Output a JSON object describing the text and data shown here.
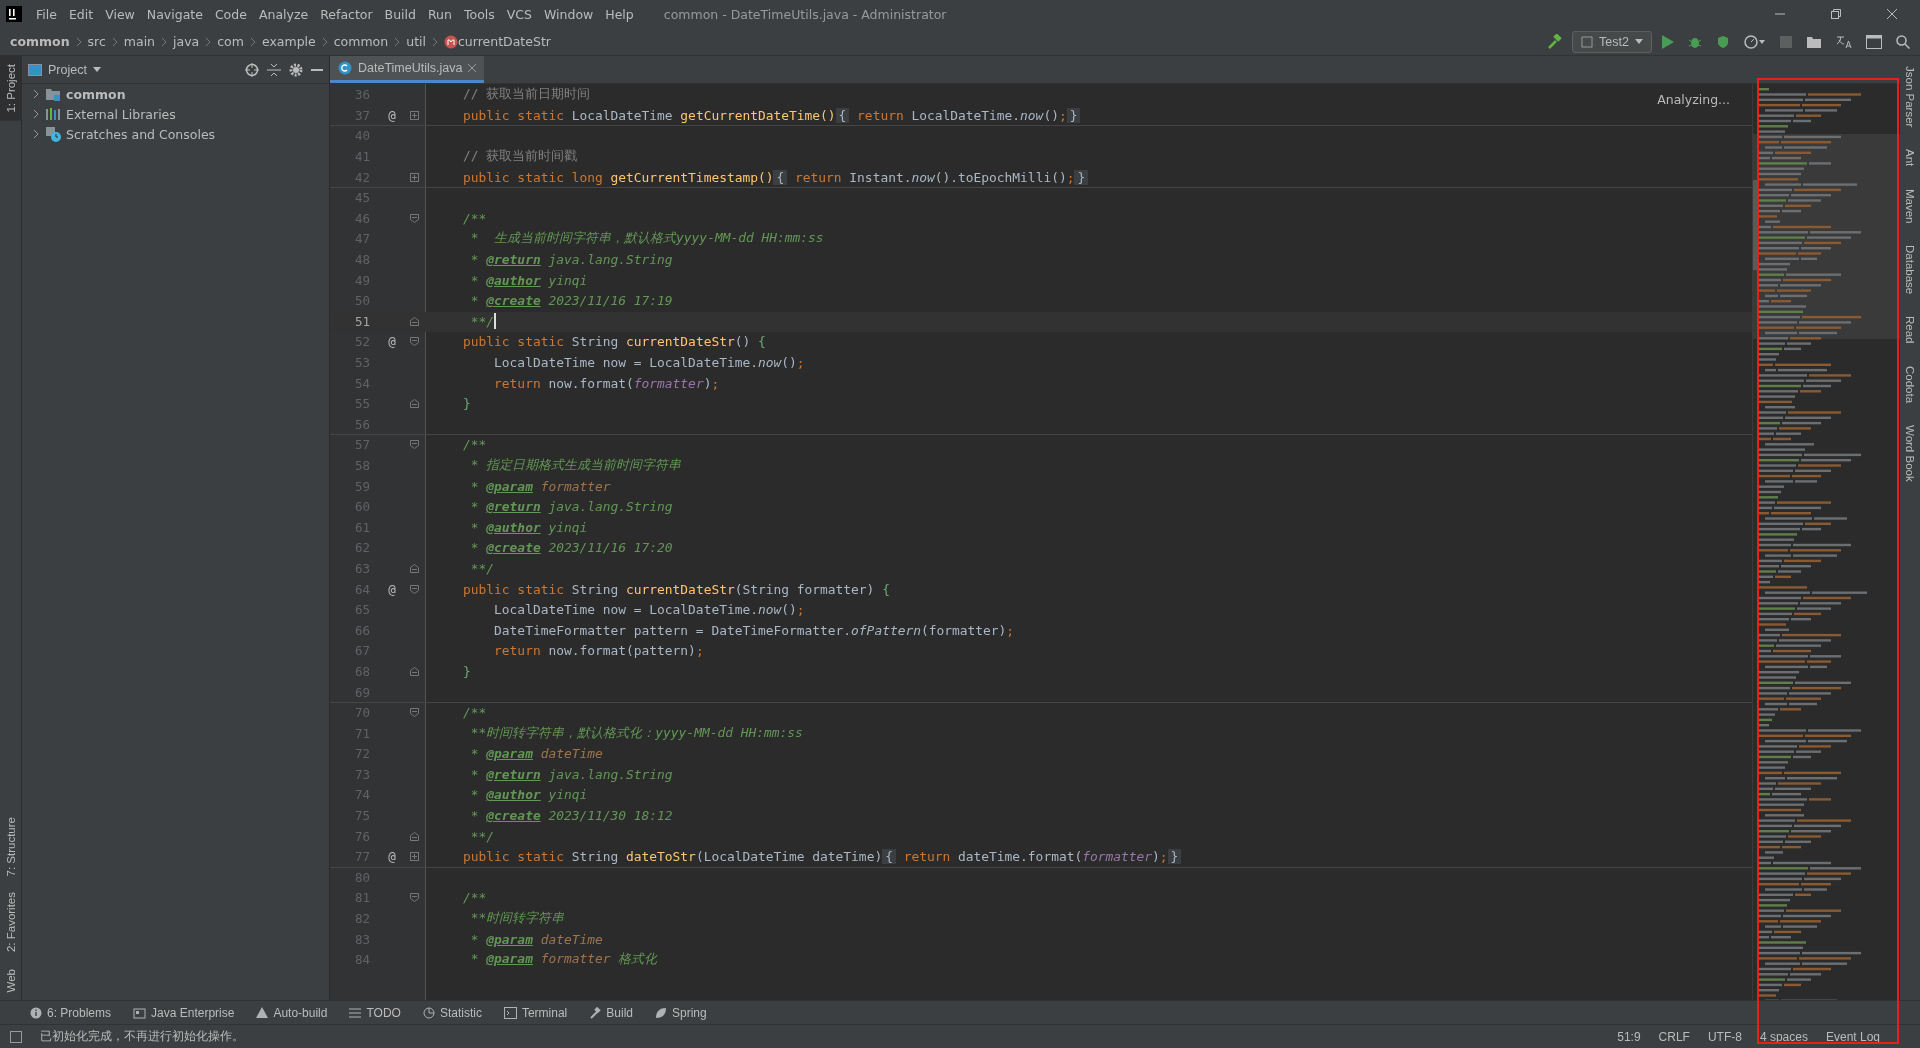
{
  "window": {
    "title": "common - DateTimeUtils.java - Administrator"
  },
  "menu": [
    "File",
    "Edit",
    "View",
    "Navigate",
    "Code",
    "Analyze",
    "Refactor",
    "Build",
    "Run",
    "Tools",
    "VCS",
    "Window",
    "Help"
  ],
  "breadcrumbs": [
    {
      "label": "common",
      "kind": "project"
    },
    {
      "label": "src",
      "kind": "dir"
    },
    {
      "label": "main",
      "kind": "dir"
    },
    {
      "label": "java",
      "kind": "dir"
    },
    {
      "label": "com",
      "kind": "dir"
    },
    {
      "label": "example",
      "kind": "dir"
    },
    {
      "label": "common",
      "kind": "dir"
    },
    {
      "label": "util",
      "kind": "dir"
    },
    {
      "label": "currentDateStr",
      "kind": "method"
    }
  ],
  "run_config": "Test2",
  "left_stripe": {
    "top": [
      {
        "label": "1: Project",
        "selected": true
      }
    ],
    "bottom": [
      {
        "label": "7: Structure",
        "selected": false
      },
      {
        "label": "2: Favorites",
        "selected": false
      },
      {
        "label": "Web",
        "selected": false
      }
    ]
  },
  "project_panel": {
    "title": "Project",
    "tree": [
      {
        "label": "common",
        "kind": "module",
        "expanded": false
      },
      {
        "label": "External Libraries",
        "kind": "libraries",
        "expanded": false
      },
      {
        "label": "Scratches and Consoles",
        "kind": "scratches",
        "expanded": false
      }
    ]
  },
  "tabs": [
    {
      "label": "DateTimeUtils.java",
      "selected": true
    }
  ],
  "editor": {
    "status": "Analyzing...",
    "lines": [
      {
        "n": "36",
        "current": false,
        "tokens": [
          {
            "kind": "cm",
            "t": "    // 获取当前日期时间"
          }
        ]
      },
      {
        "n": "37",
        "current": false,
        "gutter": "@",
        "fold": {
          "kind": "plus"
        },
        "separator": true,
        "tokens": [
          {
            "kind": "kw",
            "t": "    public static "
          },
          {
            "kind": "pl",
            "t": "LocalDateTime "
          },
          {
            "kind": "fn",
            "t": "getCurrentDateTime()"
          },
          {
            "kind": "fold",
            "t": "{"
          },
          {
            "kind": "kw",
            "t": " return "
          },
          {
            "kind": "pl",
            "t": "LocalDateTime."
          },
          {
            "kind": "st",
            "t": "now"
          },
          {
            "kind": "pl",
            "t": "()"
          },
          {
            "kind": "kw",
            "t": ";"
          },
          {
            "kind": "fold",
            "t": "}"
          }
        ]
      },
      {
        "n": "40",
        "current": false
      },
      {
        "n": "41",
        "current": false,
        "tokens": [
          {
            "kind": "cm",
            "t": "    // 获取当前时间戳"
          }
        ]
      },
      {
        "n": "42",
        "current": false,
        "fold": {
          "kind": "plus"
        },
        "separator": true,
        "tokens": [
          {
            "kind": "kw",
            "t": "    public static long "
          },
          {
            "kind": "fn",
            "t": "getCurrentTimestamp()"
          },
          {
            "kind": "fold",
            "t": "{"
          },
          {
            "kind": "kw",
            "t": " return "
          },
          {
            "kind": "pl",
            "t": "Instant."
          },
          {
            "kind": "st",
            "t": "now"
          },
          {
            "kind": "pl",
            "t": "().toEpochMilli()"
          },
          {
            "kind": "kw",
            "t": ";"
          },
          {
            "kind": "fold",
            "t": "}"
          }
        ]
      },
      {
        "n": "45",
        "current": false
      },
      {
        "n": "46",
        "current": false,
        "fold": {
          "kind": "open"
        },
        "tokens": [
          {
            "kind": "doc",
            "t": "    /**"
          }
        ]
      },
      {
        "n": "47",
        "current": false,
        "tokens": [
          {
            "kind": "doc",
            "t": "     *  生成当前时间字符串，默认格式yyyy-MM-dd HH:mm:ss"
          }
        ]
      },
      {
        "n": "48",
        "current": false,
        "tokens": [
          {
            "kind": "doc",
            "t": "     * "
          },
          {
            "kind": "tag",
            "t": "@return"
          },
          {
            "kind": "doc",
            "t": " java.lang.String"
          }
        ]
      },
      {
        "n": "49",
        "current": false,
        "tokens": [
          {
            "kind": "doc",
            "t": "     * "
          },
          {
            "kind": "tag",
            "t": "@author"
          },
          {
            "kind": "doc",
            "t": " yinqi"
          }
        ]
      },
      {
        "n": "50",
        "current": false,
        "tokens": [
          {
            "kind": "doc",
            "t": "     * "
          },
          {
            "kind": "tag",
            "t": "@create"
          },
          {
            "kind": "doc",
            "t": " 2023/11/16 17:19"
          }
        ]
      },
      {
        "n": "51",
        "current": true,
        "fold": {
          "kind": "close"
        },
        "tokens": [
          {
            "kind": "doc",
            "t": "     **/"
          }
        ]
      },
      {
        "n": "52",
        "current": false,
        "gutter": "@",
        "fold": {
          "kind": "open"
        },
        "tokens": [
          {
            "kind": "kw",
            "t": "    public static "
          },
          {
            "kind": "pl",
            "t": "String "
          },
          {
            "kind": "fn",
            "t": "currentDateStr"
          },
          {
            "kind": "pl",
            "t": "() "
          },
          {
            "kind": "br",
            "t": "{"
          }
        ]
      },
      {
        "n": "53",
        "current": false,
        "tokens": [
          {
            "kind": "pl",
            "t": "        LocalDateTime now = LocalDateTime."
          },
          {
            "kind": "st",
            "t": "now"
          },
          {
            "kind": "pl",
            "t": "()"
          },
          {
            "kind": "kw",
            "t": ";"
          }
        ]
      },
      {
        "n": "54",
        "current": false,
        "tokens": [
          {
            "kind": "kw",
            "t": "        return "
          },
          {
            "kind": "pl",
            "t": "now.format("
          },
          {
            "kind": "fld",
            "t": "formatter"
          },
          {
            "kind": "pl",
            "t": ")"
          },
          {
            "kind": "kw",
            "t": ";"
          }
        ]
      },
      {
        "n": "55",
        "current": false,
        "fold": {
          "kind": "close"
        },
        "tokens": [
          {
            "kind": "br",
            "t": "    }"
          }
        ]
      },
      {
        "n": "56",
        "current": false,
        "separator": true
      },
      {
        "n": "57",
        "current": false,
        "fold": {
          "kind": "open"
        },
        "tokens": [
          {
            "kind": "doc",
            "t": "    /**"
          }
        ]
      },
      {
        "n": "58",
        "current": false,
        "tokens": [
          {
            "kind": "doc",
            "t": "     * 指定日期格式生成当前时间字符串"
          }
        ]
      },
      {
        "n": "59",
        "current": false,
        "tokens": [
          {
            "kind": "doc",
            "t": "     * "
          },
          {
            "kind": "tag",
            "t": "@param"
          },
          {
            "kind": "dpar",
            "t": " formatter"
          }
        ]
      },
      {
        "n": "60",
        "current": false,
        "tokens": [
          {
            "kind": "doc",
            "t": "     * "
          },
          {
            "kind": "tag",
            "t": "@return"
          },
          {
            "kind": "doc",
            "t": " java.lang.String"
          }
        ]
      },
      {
        "n": "61",
        "current": false,
        "tokens": [
          {
            "kind": "doc",
            "t": "     * "
          },
          {
            "kind": "tag",
            "t": "@author"
          },
          {
            "kind": "doc",
            "t": " yinqi"
          }
        ]
      },
      {
        "n": "62",
        "current": false,
        "tokens": [
          {
            "kind": "doc",
            "t": "     * "
          },
          {
            "kind": "tag",
            "t": "@create"
          },
          {
            "kind": "doc",
            "t": " 2023/11/16 17:20"
          }
        ]
      },
      {
        "n": "63",
        "current": false,
        "fold": {
          "kind": "close"
        },
        "tokens": [
          {
            "kind": "doc",
            "t": "     **/"
          }
        ]
      },
      {
        "n": "64",
        "current": false,
        "gutter": "@",
        "fold": {
          "kind": "open"
        },
        "tokens": [
          {
            "kind": "kw",
            "t": "    public static "
          },
          {
            "kind": "pl",
            "t": "String "
          },
          {
            "kind": "fn",
            "t": "currentDateStr"
          },
          {
            "kind": "pl",
            "t": "(String formatter) "
          },
          {
            "kind": "br",
            "t": "{"
          }
        ]
      },
      {
        "n": "65",
        "current": false,
        "tokens": [
          {
            "kind": "pl",
            "t": "        LocalDateTime now = LocalDateTime."
          },
          {
            "kind": "st",
            "t": "now"
          },
          {
            "kind": "pl",
            "t": "()"
          },
          {
            "kind": "kw",
            "t": ";"
          }
        ]
      },
      {
        "n": "66",
        "current": false,
        "tokens": [
          {
            "kind": "pl",
            "t": "        DateTimeFormatter pattern = DateTimeFormatter."
          },
          {
            "kind": "st",
            "t": "ofPattern"
          },
          {
            "kind": "pl",
            "t": "(formatter)"
          },
          {
            "kind": "kw",
            "t": ";"
          }
        ]
      },
      {
        "n": "67",
        "current": false,
        "tokens": [
          {
            "kind": "kw",
            "t": "        return "
          },
          {
            "kind": "pl",
            "t": "now.format(pattern)"
          },
          {
            "kind": "kw",
            "t": ";"
          }
        ]
      },
      {
        "n": "68",
        "current": false,
        "fold": {
          "kind": "close"
        },
        "tokens": [
          {
            "kind": "br",
            "t": "    }"
          }
        ]
      },
      {
        "n": "69",
        "current": false,
        "separator": true
      },
      {
        "n": "70",
        "current": false,
        "fold": {
          "kind": "open"
        },
        "tokens": [
          {
            "kind": "doc",
            "t": "    /**"
          }
        ]
      },
      {
        "n": "71",
        "current": false,
        "tokens": [
          {
            "kind": "doc",
            "t": "     **时间转字符串，默认格式化：yyyy-MM-dd HH:mm:ss"
          }
        ]
      },
      {
        "n": "72",
        "current": false,
        "tokens": [
          {
            "kind": "doc",
            "t": "     * "
          },
          {
            "kind": "tag",
            "t": "@param"
          },
          {
            "kind": "dpar",
            "t": " dateTime"
          }
        ]
      },
      {
        "n": "73",
        "current": false,
        "tokens": [
          {
            "kind": "doc",
            "t": "     * "
          },
          {
            "kind": "tag",
            "t": "@return"
          },
          {
            "kind": "doc",
            "t": " java.lang.String"
          }
        ]
      },
      {
        "n": "74",
        "current": false,
        "tokens": [
          {
            "kind": "doc",
            "t": "     * "
          },
          {
            "kind": "tag",
            "t": "@author"
          },
          {
            "kind": "doc",
            "t": " yinqi"
          }
        ]
      },
      {
        "n": "75",
        "current": false,
        "tokens": [
          {
            "kind": "doc",
            "t": "     * "
          },
          {
            "kind": "tag",
            "t": "@create"
          },
          {
            "kind": "doc",
            "t": " 2023/11/30 18:12"
          }
        ]
      },
      {
        "n": "76",
        "current": false,
        "fold": {
          "kind": "close"
        },
        "tokens": [
          {
            "kind": "doc",
            "t": "     **/"
          }
        ]
      },
      {
        "n": "77",
        "current": false,
        "gutter": "@",
        "fold": {
          "kind": "plus"
        },
        "separator": true,
        "tokens": [
          {
            "kind": "kw",
            "t": "    public static "
          },
          {
            "kind": "pl",
            "t": "String "
          },
          {
            "kind": "fn",
            "t": "dateToStr"
          },
          {
            "kind": "pl",
            "t": "(LocalDateTime dateTime)"
          },
          {
            "kind": "fold",
            "t": "{"
          },
          {
            "kind": "kw",
            "t": " return "
          },
          {
            "kind": "pl",
            "t": "dateTime.format("
          },
          {
            "kind": "fld",
            "t": "formatter"
          },
          {
            "kind": "pl",
            "t": ")"
          },
          {
            "kind": "kw",
            "t": ";"
          },
          {
            "kind": "fold",
            "t": "}"
          }
        ]
      },
      {
        "n": "80",
        "current": false
      },
      {
        "n": "81",
        "current": false,
        "fold": {
          "kind": "open"
        },
        "tokens": [
          {
            "kind": "doc",
            "t": "    /**"
          }
        ]
      },
      {
        "n": "82",
        "current": false,
        "tokens": [
          {
            "kind": "doc",
            "t": "     **时间转字符串"
          }
        ]
      },
      {
        "n": "83",
        "current": false,
        "tokens": [
          {
            "kind": "doc",
            "t": "     * "
          },
          {
            "kind": "tag",
            "t": "@param"
          },
          {
            "kind": "dpar",
            "t": " dateTime"
          }
        ]
      },
      {
        "n": "84",
        "current": false,
        "tokens": [
          {
            "kind": "doc",
            "t": "     * "
          },
          {
            "kind": "tag",
            "t": "@param"
          },
          {
            "kind": "dpar",
            "t": " formatter"
          },
          {
            "kind": "doc",
            "t": " 格式化"
          }
        ]
      }
    ]
  },
  "right_stripe": [
    "Json Parser",
    "Ant",
    "Maven",
    "Database",
    "Read",
    "Codota",
    "Word Book"
  ],
  "tool_buttons": [
    {
      "label": "6: Problems",
      "kind": "problems"
    },
    {
      "label": "Java Enterprise",
      "kind": "enterprise"
    },
    {
      "label": "Auto-build",
      "kind": "warning"
    },
    {
      "label": "TODO",
      "kind": "list"
    },
    {
      "label": "Statistic",
      "kind": "chart"
    },
    {
      "label": "Terminal",
      "kind": "terminal"
    },
    {
      "label": "Build",
      "kind": "hammer"
    },
    {
      "label": "Spring",
      "kind": "leaf"
    }
  ],
  "status_bar": {
    "message": "已初始化完成，不再进行初始化操作。",
    "items": [
      "51:9",
      "CRLF",
      "UTF-8",
      "4 spaces"
    ],
    "event_log": "Event Log"
  }
}
